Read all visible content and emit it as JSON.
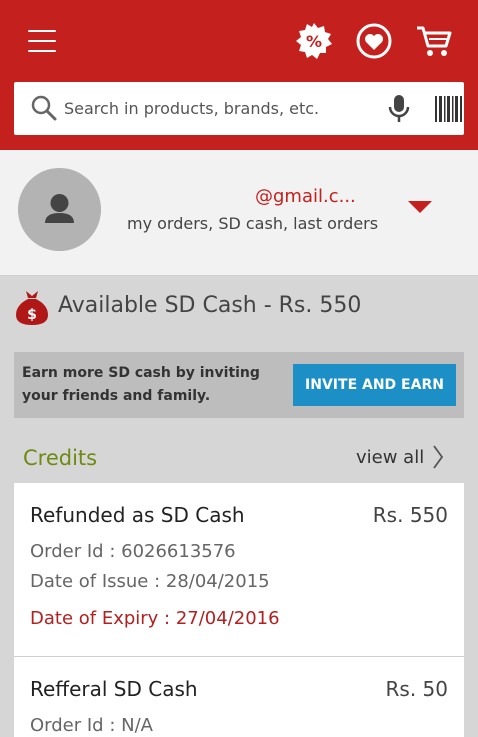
{
  "header": {
    "search_placeholder": "Search in products, brands, etc.",
    "icons": [
      "menu-icon",
      "offers-icon",
      "wishlist-icon",
      "cart-icon",
      "search-icon",
      "mic-icon",
      "barcode-icon"
    ],
    "brand_color": "#c4201e"
  },
  "profile": {
    "email": "@gmail.c...",
    "subtitle": "my orders, SD cash, last orders"
  },
  "sd_cash": {
    "title": "Available SD Cash - Rs. 550"
  },
  "invite": {
    "text": "Earn more SD cash by inviting your friends and family.",
    "button_label": "INVITE AND EARN",
    "button_color": "#1b8fc6"
  },
  "credits": {
    "heading": "Credits",
    "view_all": "view all",
    "items": [
      {
        "title": "Refunded as SD Cash",
        "amount": "Rs. 550",
        "order_id": "Order Id : 6026613576",
        "issue": "Date of Issue :  28/04/2015",
        "expiry": "Date of Expiry :  27/04/2016"
      },
      {
        "title": "Refferal SD Cash",
        "amount": "Rs. 50",
        "order_id": "Order Id : N/A"
      }
    ]
  }
}
